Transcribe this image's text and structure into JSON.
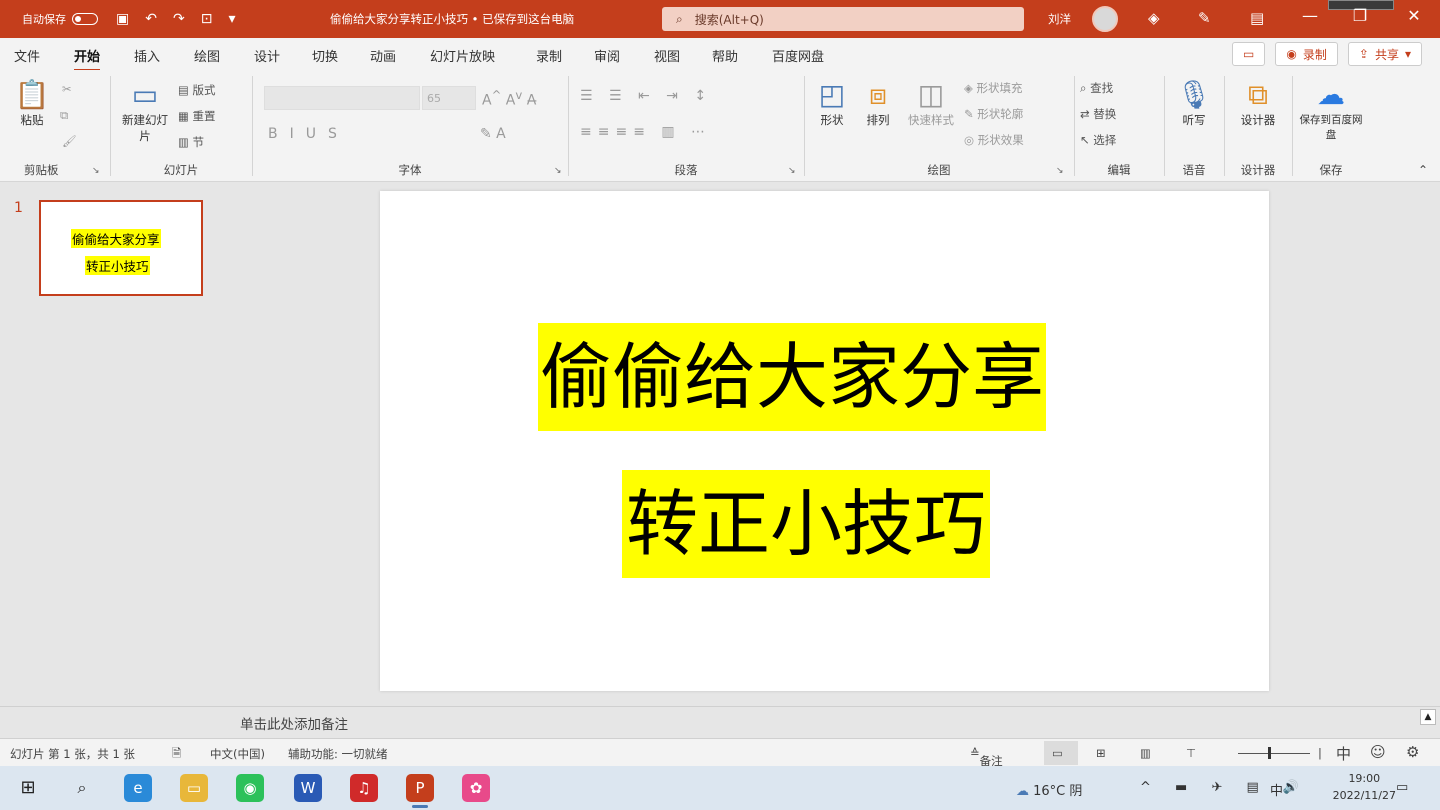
{
  "titlebar": {
    "autosave": "自动保存",
    "autosave_state": "关",
    "doc_title": "偷偷给大家分享转正小技巧 • 已保存到这台电脑",
    "search_placeholder": "搜索(Alt+Q)",
    "user": "刘洋"
  },
  "tabs": [
    "文件",
    "开始",
    "插入",
    "绘图",
    "设计",
    "切换",
    "动画",
    "幻灯片放映",
    "录制",
    "审阅",
    "视图",
    "帮助",
    "百度网盘"
  ],
  "tabs_right": {
    "record": "录制",
    "share": "共享"
  },
  "ribbon": {
    "clipboard": {
      "paste": "粘贴",
      "label": "剪贴板"
    },
    "slides": {
      "new_slide": "新建幻灯片",
      "layout": "版式",
      "reset": "重置",
      "section": "节",
      "label": "幻灯片"
    },
    "font": {
      "size": "65",
      "label": "字体"
    },
    "paragraph": {
      "label": "段落"
    },
    "drawing": {
      "shapes": "形状",
      "arrange": "排列",
      "quick_styles": "快速样式",
      "fill": "形状填充",
      "outline": "形状轮廓",
      "effects": "形状效果",
      "label": "绘图"
    },
    "editing": {
      "find": "查找",
      "replace": "替换",
      "select": "选择",
      "label": "编辑"
    },
    "voice": {
      "dictate": "听写",
      "label": "语音"
    },
    "designer": {
      "ideas": "设计器",
      "label": "设计器"
    },
    "baidu": {
      "save": "保存到百度网盘",
      "label": "保存"
    }
  },
  "thumbnail": {
    "number": "1",
    "line1": "偷偷给大家分享",
    "line2": "转正小技巧"
  },
  "slide": {
    "line1": "偷偷给大家分享",
    "line2": "转正小技巧"
  },
  "notes": {
    "placeholder": "单击此处添加备注"
  },
  "status": {
    "slide_info": "幻灯片 第 1 张，共 1 张",
    "language": "中文(中国)",
    "accessibility": "辅助功能: 一切就绪",
    "notes": "备注"
  },
  "taskbar": {
    "weather": "16°C 阴",
    "ime": "中",
    "time": "19:00",
    "date": "2022/11/27"
  }
}
